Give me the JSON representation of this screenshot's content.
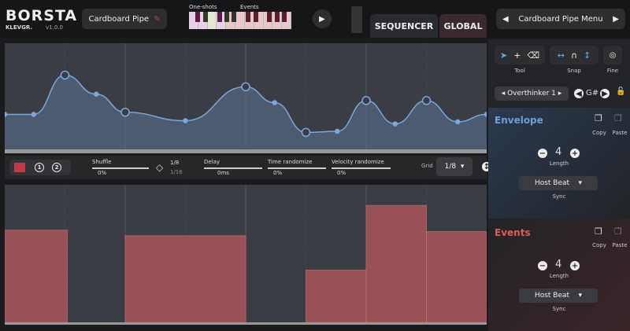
{
  "header": {
    "app": "BORSTA",
    "brand": "KLEVGR.",
    "version": "v1.0.0",
    "preset": "Cardboard Pipe",
    "oneshots_label": "One-shots",
    "events_label": "Events",
    "tabs": [
      "SEQUENCER",
      "GLOBAL"
    ],
    "menu": "Cardboard Pipe Menu"
  },
  "controls": {
    "shuffle": "Shuffle",
    "shuffle_val": "0%",
    "shuffle_opts": [
      "1/8",
      "1/16"
    ],
    "delay": "Delay",
    "delay_val": "0ms",
    "time_rand": "Time randomize",
    "time_val": "0%",
    "vel_rand": "Velocity randomize",
    "vel_val": "0%",
    "grid": "Grid",
    "grid_val": "1/8",
    "btn1": "1",
    "btn2": "2"
  },
  "side": {
    "tool": "Tool",
    "snap": "Snap",
    "fine": "Fine",
    "instrument": "Overthinker 1",
    "note": "G#",
    "envelope": {
      "title": "Envelope",
      "copy": "Copy",
      "paste": "Paste",
      "length": "4",
      "length_label": "Length",
      "sync": "Host Beat",
      "sync_label": "Sync"
    },
    "events": {
      "title": "Events",
      "copy": "Copy",
      "paste": "Paste",
      "length": "4",
      "length_label": "Length",
      "sync": "Host Beat",
      "sync_label": "Sync"
    }
  },
  "envelope_points": [
    [
      0,
      0.33
    ],
    [
      0.06,
      0.33
    ],
    [
      0.125,
      0.7
    ],
    [
      0.19,
      0.52
    ],
    [
      0.25,
      0.35
    ],
    [
      0.375,
      0.27
    ],
    [
      0.5,
      0.59
    ],
    [
      0.56,
      0.44
    ],
    [
      0.625,
      0.16
    ],
    [
      0.69,
      0.17
    ],
    [
      0.75,
      0.46
    ],
    [
      0.81,
      0.24
    ],
    [
      0.875,
      0.46
    ],
    [
      0.94,
      0.26
    ],
    [
      1,
      0.33
    ]
  ],
  "bars": [
    [
      0,
      0.13,
      0.67
    ],
    [
      0.25,
      0.5,
      0.63
    ],
    [
      0.625,
      0.75,
      0.38
    ],
    [
      0.75,
      0.875,
      0.85
    ],
    [
      0.875,
      1,
      0.66
    ]
  ],
  "colors": {
    "accent": "#7aa7e0",
    "events": "#e05a5a",
    "bar": "#b85a5e"
  }
}
